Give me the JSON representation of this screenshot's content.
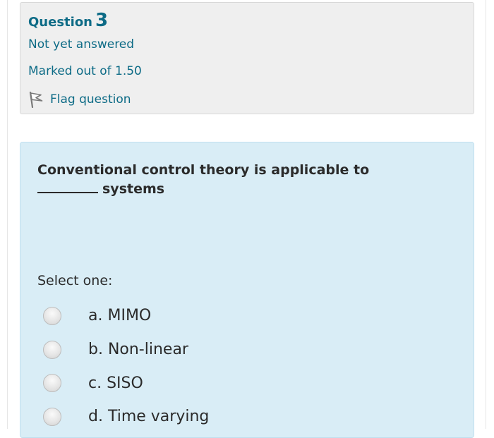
{
  "info": {
    "question_label": "Question",
    "question_number": "3",
    "state": "Not yet answered",
    "grade": "Marked out of 1.50",
    "flag_label": "Flag question",
    "flag_icon": "flag-icon"
  },
  "question": {
    "text_line1": "Conventional control theory is applicable to",
    "blank": "_______",
    "text_line2": "systems"
  },
  "answer": {
    "prompt": "Select one:",
    "options": [
      {
        "letter": "a.",
        "label": "a. MIMO"
      },
      {
        "letter": "b.",
        "label": "b. Non-linear"
      },
      {
        "letter": "c.",
        "label": "c.  SISO"
      },
      {
        "letter": "d.",
        "label": "d. Time varying"
      }
    ],
    "selected": null
  },
  "colors": {
    "link_teal": "#0d6b86",
    "info_bg": "#efefef",
    "content_bg": "#d9edf6",
    "text": "#2b2b2b"
  }
}
